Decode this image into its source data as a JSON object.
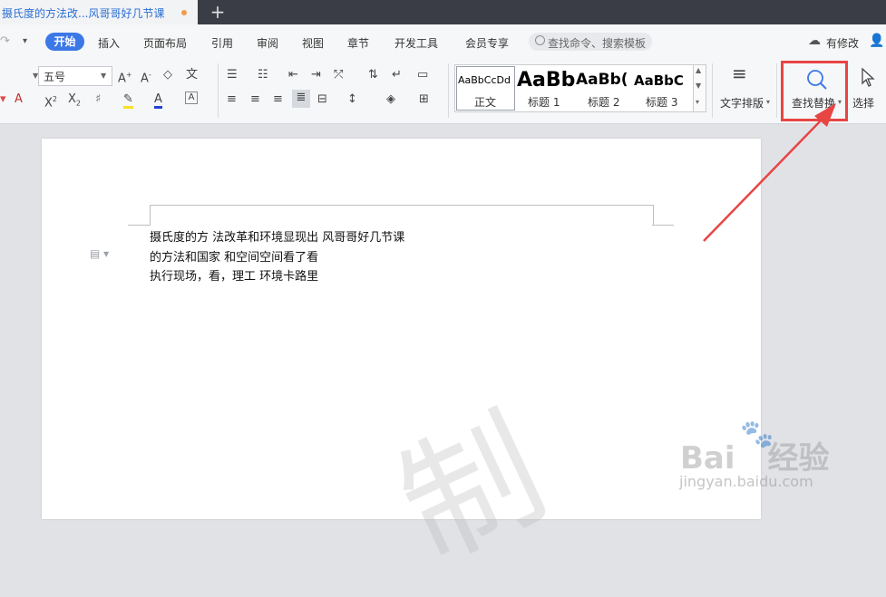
{
  "tab": {
    "title": "摄氏度的方法改...风哥哥好几节课",
    "new_tab": "+"
  },
  "menu": {
    "items": [
      "开始",
      "插入",
      "页面布局",
      "引用",
      "审阅",
      "视图",
      "章节",
      "开发工具",
      "会员专享"
    ],
    "search_placeholder": "查找命令、搜索模板",
    "modified": "有修改"
  },
  "ribbon": {
    "font_size": "五号",
    "styles": [
      {
        "preview": "AaBbCcDd",
        "name": "正文"
      },
      {
        "preview": "AaBb",
        "name": "标题 1"
      },
      {
        "preview": "AaBb(",
        "name": "标题 2"
      },
      {
        "preview": "AaBbC",
        "name": "标题 3"
      }
    ],
    "text_layout": "文字排版",
    "find_replace": "查找替换",
    "select": "选择"
  },
  "document": {
    "lines": [
      "摄氏度的方 法改革和环境显现出 风哥哥好几节课",
      "的方法和国家 和空间空间看了看",
      "执行现场，看，理工 环境卡路里"
    ]
  },
  "watermark": {
    "logo": "Bai",
    "logo_cn": "经验",
    "url": "jingyan.baidu.com",
    "big": "制"
  },
  "colors": {
    "accent": "#3b78e7",
    "highlight_frame": "#e84545",
    "tab_bar": "#3a3d45"
  }
}
